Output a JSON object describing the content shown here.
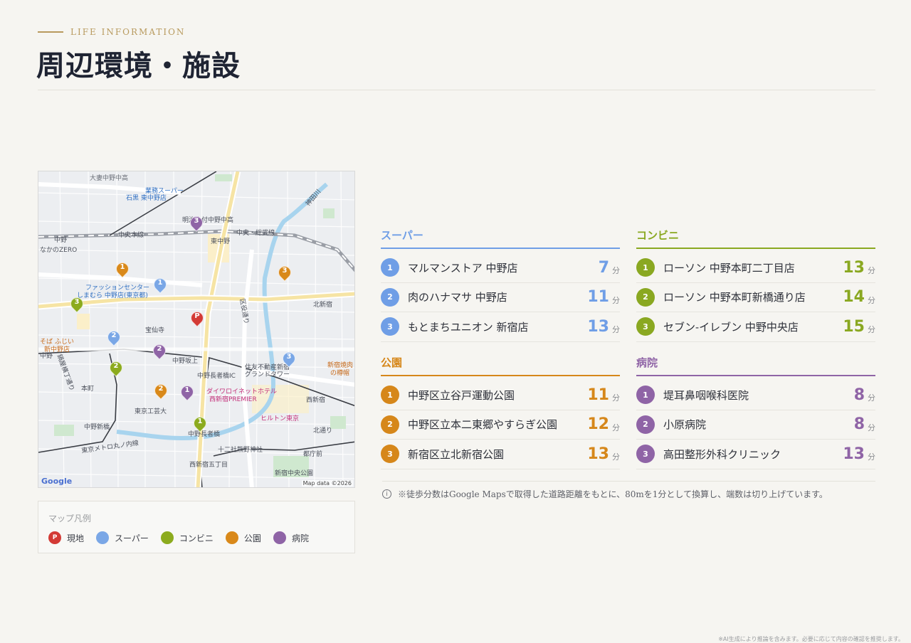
{
  "header": {
    "eyebrow": "LIFE INFORMATION",
    "title": "周辺環境・施設"
  },
  "map": {
    "google_logo": "Google",
    "attribution": "Map data ©2026",
    "labels": [
      {
        "text": "大妻中野中高",
        "style": "gray"
      },
      {
        "text": "業務スーパー",
        "style": "blue"
      },
      {
        "text": "石黒 東中野店",
        "style": "blue"
      },
      {
        "text": "明治大付中野中高",
        "style": ""
      },
      {
        "text": "中央本線",
        "style": ""
      },
      {
        "text": "東中野",
        "style": ""
      },
      {
        "text": "中央・総武線",
        "style": ""
      },
      {
        "text": "中野",
        "style": ""
      },
      {
        "text": "なかのZERO",
        "style": ""
      },
      {
        "text": "ファッションセンター",
        "style": "blue"
      },
      {
        "text": "しまむら 中野店(東京都)",
        "style": "blue"
      },
      {
        "text": "北新宿",
        "style": ""
      },
      {
        "text": "宝仙寺",
        "style": ""
      },
      {
        "text": "そば ふじい",
        "style": "orange"
      },
      {
        "text": "新中野店",
        "style": "orange"
      },
      {
        "text": "中野",
        "style": ""
      },
      {
        "text": "中野坂上",
        "style": ""
      },
      {
        "text": "中野長者橋IC",
        "style": ""
      },
      {
        "text": "住友不動産新宿",
        "style": ""
      },
      {
        "text": "グランドタワー",
        "style": ""
      },
      {
        "text": "新宿焼肉",
        "style": "orange"
      },
      {
        "text": "の樽帽",
        "style": "orange"
      },
      {
        "text": "本町",
        "style": ""
      },
      {
        "text": "ダイワロイネットホテル",
        "style": "pink"
      },
      {
        "text": "西新宿PREMIER",
        "style": "pink"
      },
      {
        "text": "西新宿",
        "style": ""
      },
      {
        "text": "東京工芸大",
        "style": ""
      },
      {
        "text": "ヒルトン東京",
        "style": "pink"
      },
      {
        "text": "中野新橋",
        "style": ""
      },
      {
        "text": "中野長者橋",
        "style": ""
      },
      {
        "text": "北通り",
        "style": ""
      },
      {
        "text": "十二社熊野神社",
        "style": ""
      },
      {
        "text": "都庁前",
        "style": ""
      },
      {
        "text": "西新宿五丁目",
        "style": ""
      },
      {
        "text": "新宿中央公園",
        "style": ""
      },
      {
        "text": "区役通り",
        "style": ""
      },
      {
        "text": "神田川",
        "style": ""
      },
      {
        "text": "鍋屋横丁通り",
        "style": ""
      },
      {
        "text": "東京メトロ丸ノ内線",
        "style": ""
      }
    ],
    "markers": [
      {
        "type": "site",
        "label": "P",
        "color": "#d33a35"
      },
      {
        "type": "super",
        "label": "1",
        "color": "#7aa7e6"
      },
      {
        "type": "super",
        "label": "2",
        "color": "#7aa7e6"
      },
      {
        "type": "super",
        "label": "3",
        "color": "#7aa7e6"
      },
      {
        "type": "conv",
        "label": "1",
        "color": "#8cab1e"
      },
      {
        "type": "conv",
        "label": "2",
        "color": "#8cab1e"
      },
      {
        "type": "conv",
        "label": "3",
        "color": "#8cab1e"
      },
      {
        "type": "park",
        "label": "1",
        "color": "#d9891a"
      },
      {
        "type": "park",
        "label": "2",
        "color": "#d9891a"
      },
      {
        "type": "park",
        "label": "3",
        "color": "#d9891a"
      },
      {
        "type": "hosp",
        "label": "1",
        "color": "#8f64a6"
      },
      {
        "type": "hosp",
        "label": "2",
        "color": "#8f64a6"
      },
      {
        "type": "hosp",
        "label": "3",
        "color": "#8f64a6"
      }
    ]
  },
  "legend": {
    "title": "マップ凡例",
    "items": [
      {
        "label": "現地",
        "color": "#d33a35",
        "mark": "P"
      },
      {
        "label": "スーパー",
        "color": "#7aa7e6",
        "mark": ""
      },
      {
        "label": "コンビニ",
        "color": "#8cab1e",
        "mark": ""
      },
      {
        "label": "公園",
        "color": "#d9891a",
        "mark": ""
      },
      {
        "label": "病院",
        "color": "#8f64a6",
        "mark": ""
      }
    ]
  },
  "categories": {
    "super": {
      "title": "スーパー",
      "color": "#6f9ee6",
      "items": [
        {
          "num": "1",
          "name": "マルマンストア 中野店",
          "minutes": "7",
          "unit": "分"
        },
        {
          "num": "2",
          "name": "肉のハナマサ 中野店",
          "minutes": "11",
          "unit": "分"
        },
        {
          "num": "3",
          "name": "もとまちユニオン 新宿店",
          "minutes": "13",
          "unit": "分"
        }
      ]
    },
    "conv": {
      "title": "コンビニ",
      "color": "#8aa821",
      "items": [
        {
          "num": "1",
          "name": "ローソン 中野本町二丁目店",
          "minutes": "13",
          "unit": "分"
        },
        {
          "num": "2",
          "name": "ローソン 中野本町新橋通り店",
          "minutes": "14",
          "unit": "分"
        },
        {
          "num": "3",
          "name": "セブン-イレブン 中野中央店",
          "minutes": "15",
          "unit": "分"
        }
      ]
    },
    "park": {
      "title": "公園",
      "color": "#d6871a",
      "items": [
        {
          "num": "1",
          "name": "中野区立谷戸運動公園",
          "minutes": "11",
          "unit": "分"
        },
        {
          "num": "2",
          "name": "中野区立本二東郷やすらぎ公園",
          "minutes": "12",
          "unit": "分"
        },
        {
          "num": "3",
          "name": "新宿区立北新宿公園",
          "minutes": "13",
          "unit": "分"
        }
      ]
    },
    "hosp": {
      "title": "病院",
      "color": "#8f64a6",
      "items": [
        {
          "num": "1",
          "name": "堤耳鼻咽喉科医院",
          "minutes": "8",
          "unit": "分"
        },
        {
          "num": "2",
          "name": "小原病院",
          "minutes": "8",
          "unit": "分"
        },
        {
          "num": "3",
          "name": "高田整形外科クリニック",
          "minutes": "13",
          "unit": "分"
        }
      ]
    }
  },
  "note": {
    "icon": "i",
    "text": "※徒歩分数はGoogle Mapsで取得した道路距離をもとに、80mを1分として換算し、端数は切り上げています。"
  },
  "footnote": "※AI生成により推論を含みます。必要に応じて内容の確認を推奨します。"
}
